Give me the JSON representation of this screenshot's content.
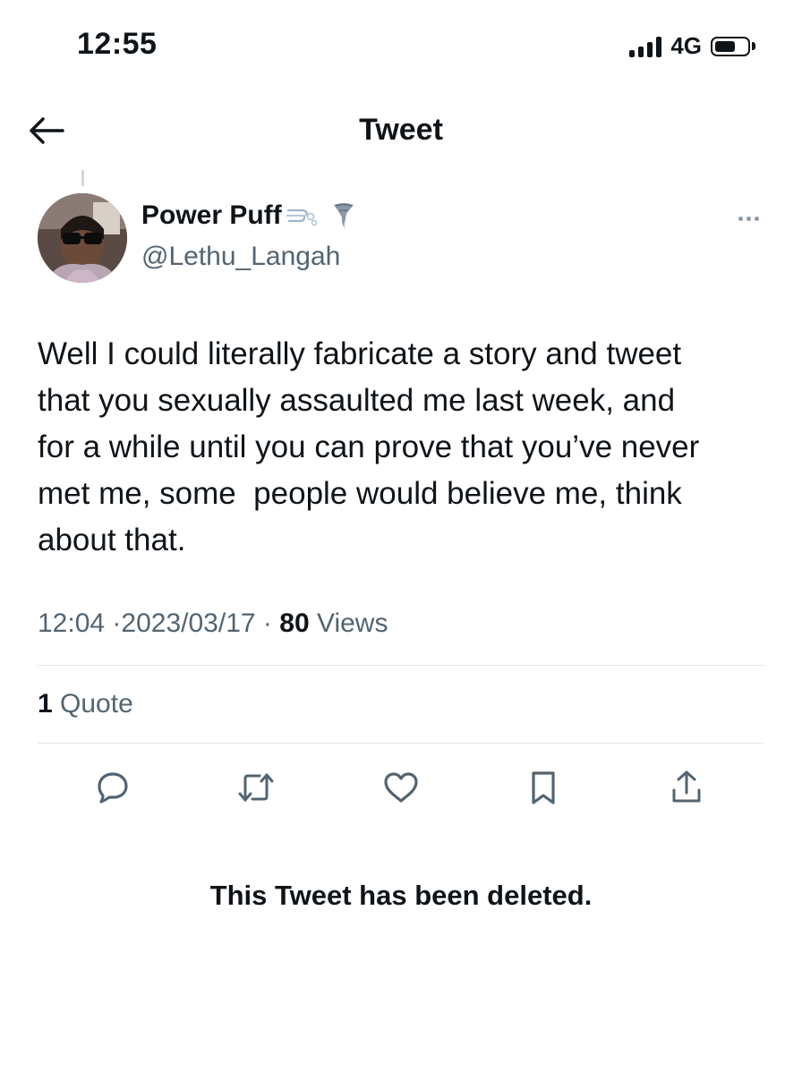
{
  "status_bar": {
    "time": "12:55",
    "network": "4G",
    "signal_icon": "signal-bars-icon",
    "battery_icon": "battery-icon"
  },
  "nav": {
    "back_icon": "arrow-left-icon",
    "title": "Tweet"
  },
  "tweet": {
    "author": {
      "display_name": "Power Puff",
      "name_emojis": [
        "dash-icon",
        "tornado-icon"
      ],
      "handle": "@Lethu_Langah"
    },
    "text": "Well I could literally fabricate a story and tweet\nthat you sexually assaulted me last week, and\nfor a while until you can prove that you’ve never\nmet me, some  people would believe me, think\nabout that.",
    "meta": {
      "time": "12:04",
      "date": "2023/03/17",
      "views_count": "80",
      "views_label": "Views",
      "separator": "·"
    },
    "stats": {
      "quote_count": "1",
      "quote_label": "Quote"
    },
    "actions": [
      {
        "name": "reply-icon"
      },
      {
        "name": "retweet-icon"
      },
      {
        "name": "like-icon"
      },
      {
        "name": "bookmark-icon"
      },
      {
        "name": "share-icon"
      }
    ]
  },
  "notice": "This Tweet has been deleted.",
  "colors": {
    "text_primary": "#0f1419",
    "text_secondary": "#536471",
    "divider": "#e1e8ed"
  }
}
